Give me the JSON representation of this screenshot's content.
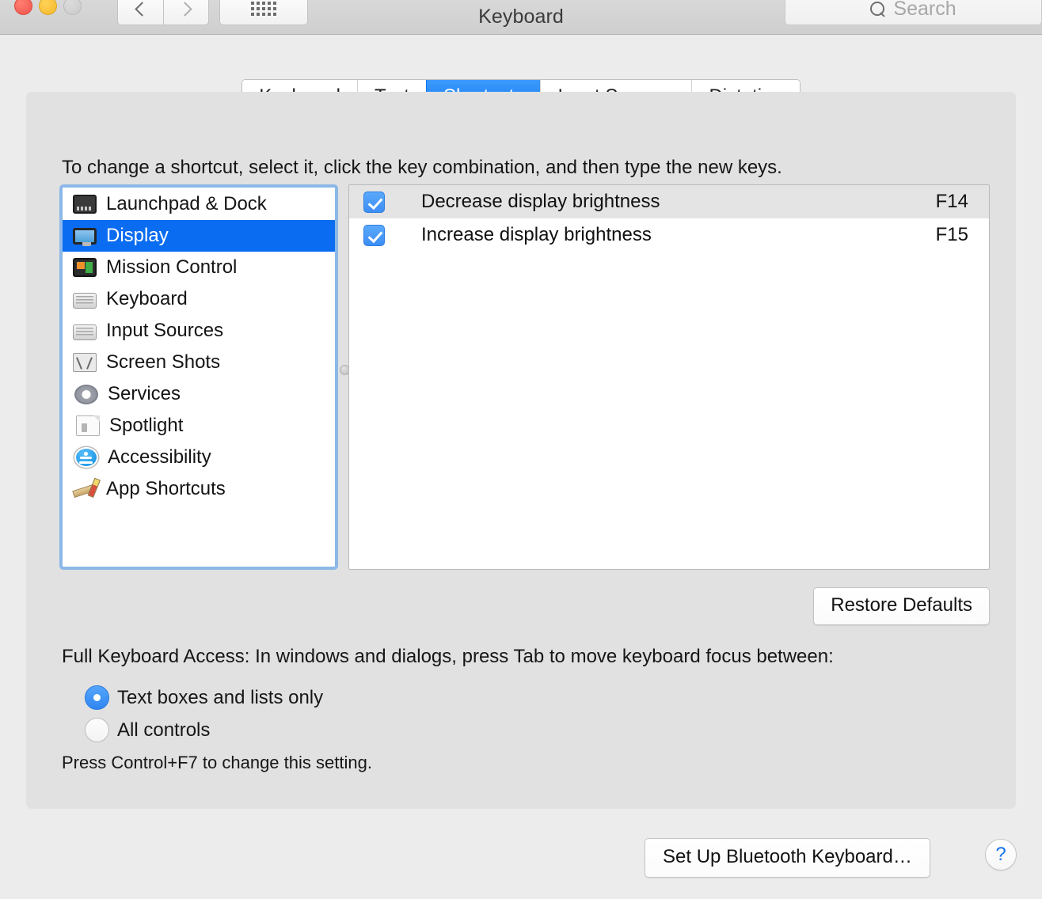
{
  "window": {
    "title": "Keyboard",
    "traffic_lights": [
      "close",
      "minimize",
      "zoom"
    ],
    "nav_back_icon": "chevron-left-icon",
    "nav_forward_icon": "chevron-right-icon",
    "grid_icon": "show-all-icon",
    "search": {
      "placeholder": "Search",
      "value": "",
      "icon": "search-icon"
    }
  },
  "tabs": [
    {
      "label": "Keyboard",
      "active": false
    },
    {
      "label": "Text",
      "active": false
    },
    {
      "label": "Shortcuts",
      "active": true
    },
    {
      "label": "Input Sources",
      "active": false
    },
    {
      "label": "Dictation",
      "active": false
    }
  ],
  "main": {
    "hint": "To change a shortcut, select it, click the key combination, and then type the new keys.",
    "categories": [
      {
        "label": "Launchpad & Dock",
        "icon": "launchpad-dock-icon",
        "selected": false
      },
      {
        "label": "Display",
        "icon": "display-icon",
        "selected": true
      },
      {
        "label": "Mission Control",
        "icon": "mission-control-icon",
        "selected": false
      },
      {
        "label": "Keyboard",
        "icon": "keyboard-icon",
        "selected": false
      },
      {
        "label": "Input Sources",
        "icon": "input-sources-icon",
        "selected": false
      },
      {
        "label": "Screen Shots",
        "icon": "screen-shots-icon",
        "selected": false
      },
      {
        "label": "Services",
        "icon": "services-gear-icon",
        "selected": false
      },
      {
        "label": "Spotlight",
        "icon": "spotlight-document-icon",
        "selected": false
      },
      {
        "label": "Accessibility",
        "icon": "accessibility-icon",
        "selected": false
      },
      {
        "label": "App Shortcuts",
        "icon": "app-shortcuts-icon",
        "selected": false
      }
    ],
    "shortcuts": [
      {
        "label": "Decrease display brightness",
        "key": "F14",
        "checked": true
      },
      {
        "label": "Increase display brightness",
        "key": "F15",
        "checked": true
      }
    ],
    "restore_defaults_label": "Restore Defaults"
  },
  "full_keyboard_access": {
    "title": "Full Keyboard Access: In windows and dialogs, press Tab to move keyboard focus between:",
    "options": [
      {
        "label": "Text boxes and lists only",
        "selected": true
      },
      {
        "label": "All controls",
        "selected": false
      }
    ],
    "note": "Press Control+F7 to change this setting."
  },
  "footer": {
    "bluetooth_button_label": "Set Up Bluetooth Keyboard…",
    "help_label": "?"
  },
  "colors": {
    "accent_blue": "#0a6cf0",
    "tab_active_blue": "#1275f3",
    "focus_ring": "#8cb8e8",
    "window_bg": "#ececec",
    "panel_bg": "#e1e1e1"
  }
}
